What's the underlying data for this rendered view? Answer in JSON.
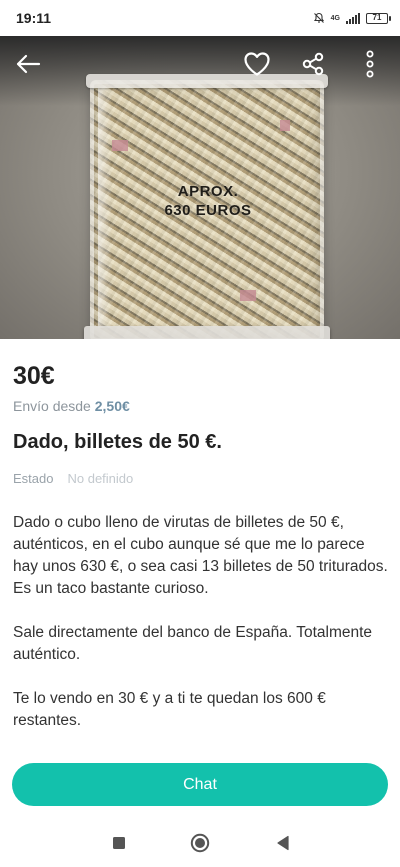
{
  "status_bar": {
    "time": "19:11",
    "battery": "71",
    "network_label": "4G"
  },
  "hero": {
    "image_description": "Clear acrylic cube filled with shredded banknotes",
    "cube_text_line1": "APROX.",
    "cube_text_line2": "630 EUROS",
    "icons": [
      "back-arrow-icon",
      "heart-icon",
      "share-icon",
      "more-vertical-icon"
    ]
  },
  "listing": {
    "price": "30€",
    "shipping_prefix": "Envío desde",
    "shipping_price": "2,50€",
    "title": "Dado, billetes de 50 €.",
    "estado_label": "Estado",
    "estado_value": "No definido",
    "description_paragraphs": [
      "Dado o cubo lleno de virutas de billetes de 50 €, auténticos, en el cubo aunque sé que me lo parece hay unos 630 €, o sea casi 13 billetes de 50 triturados. Es un taco bastante curioso.",
      "Sale directamente del banco de España. Totalmente auténtico.",
      "Te lo vendo en 30 € y a ti te quedan los 600 € restantes."
    ]
  },
  "actions": {
    "chat_label": "Chat"
  },
  "colors": {
    "accent": "#13c1ac",
    "shipping_price": "#6f8fa4",
    "muted": "#9aa3aa"
  },
  "navbar": {
    "icons": [
      "square-recents-icon",
      "circle-home-icon",
      "triangle-back-icon"
    ]
  }
}
